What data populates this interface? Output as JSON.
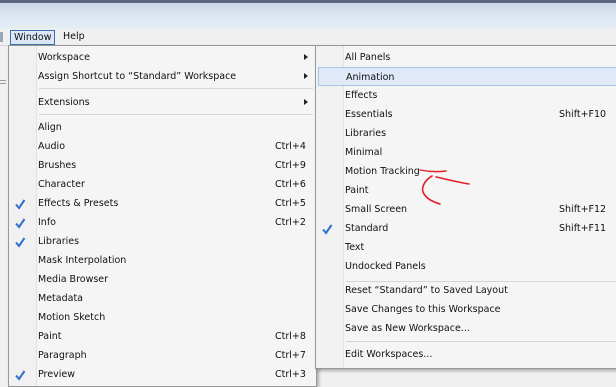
{
  "menubar": {
    "window": "Window",
    "help": "Help"
  },
  "window_menu": {
    "workspace": "Workspace",
    "assign_shortcut": "Assign Shortcut to “Standard” Workspace",
    "extensions": "Extensions",
    "items": [
      {
        "label": "Align",
        "shortcut": "",
        "checked": false
      },
      {
        "label": "Audio",
        "shortcut": "Ctrl+4",
        "checked": false
      },
      {
        "label": "Brushes",
        "shortcut": "Ctrl+9",
        "checked": false
      },
      {
        "label": "Character",
        "shortcut": "Ctrl+6",
        "checked": false
      },
      {
        "label": "Effects & Presets",
        "shortcut": "Ctrl+5",
        "checked": true
      },
      {
        "label": "Info",
        "shortcut": "Ctrl+2",
        "checked": true
      },
      {
        "label": "Libraries",
        "shortcut": "",
        "checked": true
      },
      {
        "label": "Mask Interpolation",
        "shortcut": "",
        "checked": false
      },
      {
        "label": "Media Browser",
        "shortcut": "",
        "checked": false
      },
      {
        "label": "Metadata",
        "shortcut": "",
        "checked": false
      },
      {
        "label": "Motion Sketch",
        "shortcut": "",
        "checked": false
      },
      {
        "label": "Paint",
        "shortcut": "Ctrl+8",
        "checked": false
      },
      {
        "label": "Paragraph",
        "shortcut": "Ctrl+7",
        "checked": false
      },
      {
        "label": "Preview",
        "shortcut": "Ctrl+3",
        "checked": true
      }
    ]
  },
  "workspace_menu": {
    "items": [
      {
        "label": "All Panels",
        "shortcut": "",
        "checked": false
      },
      {
        "label": "Animation",
        "shortcut": "",
        "checked": false
      },
      {
        "label": "Effects",
        "shortcut": "",
        "checked": false
      },
      {
        "label": "Essentials",
        "shortcut": "Shift+F10",
        "checked": false
      },
      {
        "label": "Libraries",
        "shortcut": "",
        "checked": false
      },
      {
        "label": "Minimal",
        "shortcut": "",
        "checked": false
      },
      {
        "label": "Motion Tracking",
        "shortcut": "",
        "checked": false
      },
      {
        "label": "Paint",
        "shortcut": "",
        "checked": false
      },
      {
        "label": "Small Screen",
        "shortcut": "Shift+F12",
        "checked": false
      },
      {
        "label": "Standard",
        "shortcut": "Shift+F11",
        "checked": true
      },
      {
        "label": "Text",
        "shortcut": "",
        "checked": false
      },
      {
        "label": "Undocked Panels",
        "shortcut": "",
        "checked": false
      }
    ],
    "actions": [
      "Reset “Standard” to Saved Layout",
      "Save Changes to this Workspace",
      "Save as New Workspace...",
      "Edit Workspaces..."
    ]
  },
  "colors": {
    "highlight": "#dfe9f7",
    "check": "#2f6fd0",
    "annotation": "#e0202a"
  }
}
